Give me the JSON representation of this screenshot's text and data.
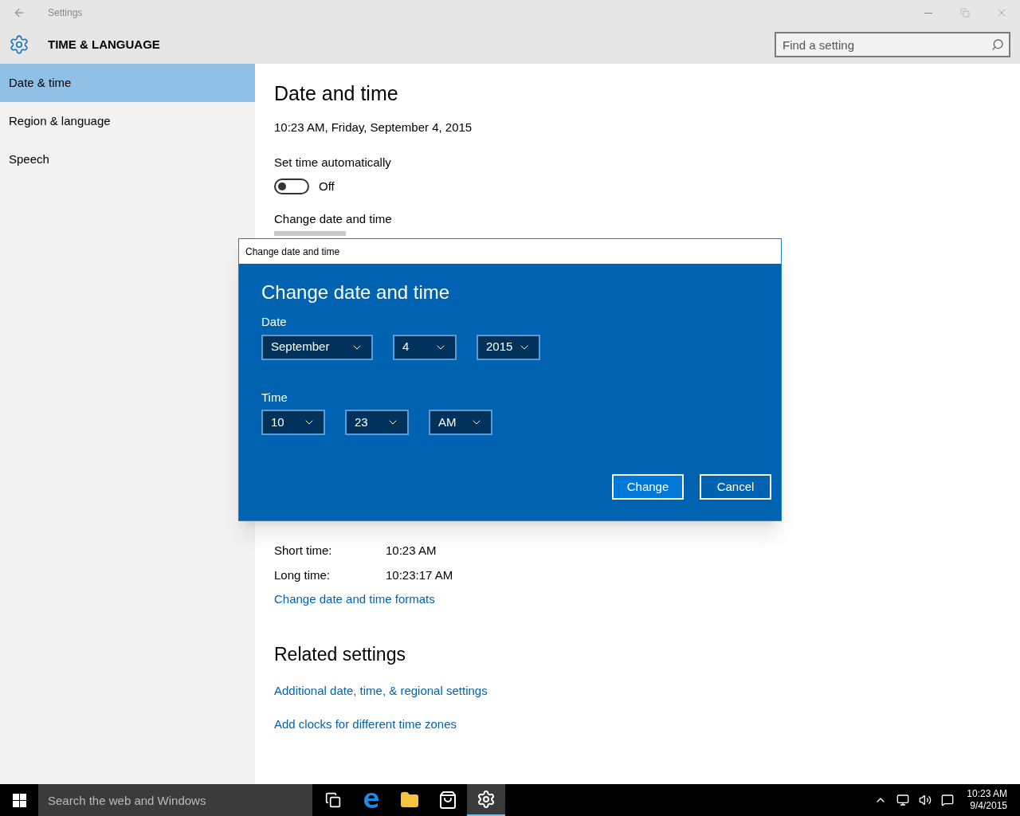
{
  "window": {
    "title": "Settings"
  },
  "header": {
    "title": "TIME & LANGUAGE",
    "search": {
      "placeholder": "Find a setting"
    }
  },
  "sidebar": {
    "items": [
      {
        "label": "Date & time",
        "selected": true
      },
      {
        "label": "Region & language",
        "selected": false
      },
      {
        "label": "Speech",
        "selected": false
      }
    ]
  },
  "content": {
    "heading": "Date and time",
    "current": "10:23 AM, Friday, September 4, 2015",
    "auto_time": {
      "label": "Set time automatically",
      "on": false,
      "state_text": "Off"
    },
    "change_label": "Change date and time",
    "formats": [
      {
        "label": "Short time:",
        "value": "10:23 AM"
      },
      {
        "label": "Long time:",
        "value": "10:23:17 AM"
      }
    ],
    "formats_link": "Change date and time formats",
    "related": {
      "heading": "Related settings",
      "links": [
        "Additional date, time, & regional settings",
        "Add clocks for different time zones"
      ]
    }
  },
  "dialog": {
    "title": "Change date and time",
    "heading": "Change date and time",
    "groups": [
      {
        "label": "Date",
        "fields": [
          "September",
          "4",
          "2015"
        ]
      },
      {
        "label": "Time",
        "fields": [
          "10",
          "23",
          "AM"
        ]
      }
    ],
    "buttons": [
      {
        "label": "Change",
        "primary": true
      },
      {
        "label": "Cancel",
        "primary": false
      }
    ]
  },
  "taskbar": {
    "search": {
      "placeholder": "Search the web and Windows"
    },
    "apps": [
      {
        "kind": "taskview",
        "selected": false
      },
      {
        "kind": "edge",
        "selected": false
      },
      {
        "kind": "folder",
        "selected": false
      },
      {
        "kind": "store",
        "selected": false
      },
      {
        "kind": "settings",
        "selected": true
      }
    ],
    "clock": {
      "time": "10:23 AM",
      "date": "9/4/2015"
    }
  }
}
